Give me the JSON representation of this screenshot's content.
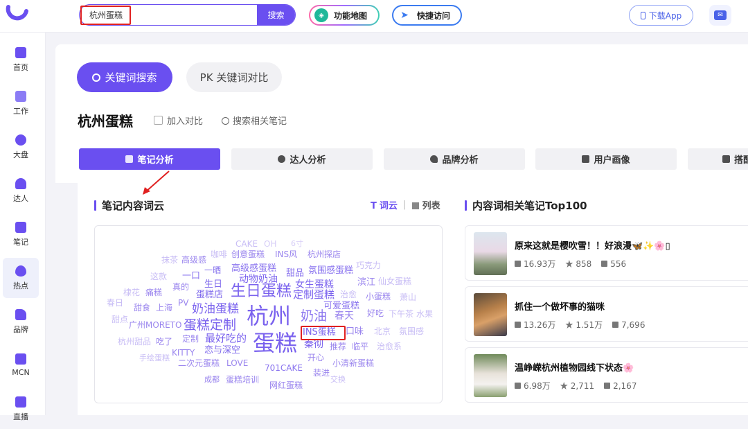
{
  "topbar": {
    "search_value": "杭州蛋糕",
    "search_button": "搜索",
    "feature_map": "功能地图",
    "quick_access": "快捷访问",
    "download_app": "下载App"
  },
  "sidebar": {
    "items": [
      {
        "label": "首页"
      },
      {
        "label": "工作"
      },
      {
        "label": "大盘"
      },
      {
        "label": "达人"
      },
      {
        "label": "笔记"
      },
      {
        "label": "热点"
      },
      {
        "label": "品牌"
      },
      {
        "label": "MCN"
      },
      {
        "label": "直播"
      }
    ]
  },
  "main": {
    "tab_keyword": "关键词搜索",
    "tab_pk": "PK 关键词对比",
    "title": "杭州蛋糕",
    "add_compare": "加入对比",
    "search_notes": "搜索相关笔记",
    "sub_tabs": [
      {
        "label": "笔记分析"
      },
      {
        "label": "达人分析"
      },
      {
        "label": "品牌分析"
      },
      {
        "label": "用户画像"
      },
      {
        "label": "搭配"
      }
    ]
  },
  "cloud_section": {
    "title": "笔记内容词云",
    "toggle_cloud": "词云",
    "toggle_list": "列表",
    "words": [
      {
        "text": "CAKE"
      },
      {
        "text": "OH"
      },
      {
        "text": "6寸"
      },
      {
        "text": "抹茶"
      },
      {
        "text": "高级感"
      },
      {
        "text": "咖啡"
      },
      {
        "text": "创意蛋糕"
      },
      {
        "text": "INS风"
      },
      {
        "text": "杭州探店"
      },
      {
        "text": "一晒"
      },
      {
        "text": "高级感蛋糕"
      },
      {
        "text": "甜品"
      },
      {
        "text": "氛围感蛋糕"
      },
      {
        "text": "巧克力"
      },
      {
        "text": "这款"
      },
      {
        "text": "一口"
      },
      {
        "text": "动物奶油"
      },
      {
        "text": "滨江"
      },
      {
        "text": "仙女蛋糕"
      },
      {
        "text": "生日"
      },
      {
        "text": "女生蛋糕"
      },
      {
        "text": "棣花"
      },
      {
        "text": "痛糕"
      },
      {
        "text": "真的"
      },
      {
        "text": "蛋糕店"
      },
      {
        "text": "生日蛋糕"
      },
      {
        "text": "定制蛋糕"
      },
      {
        "text": "治愈"
      },
      {
        "text": "小蛋糕"
      },
      {
        "text": "萧山"
      },
      {
        "text": "春日"
      },
      {
        "text": "甜食"
      },
      {
        "text": "上海"
      },
      {
        "text": "PV"
      },
      {
        "text": "奶油蛋糕"
      },
      {
        "text": "杭州"
      },
      {
        "text": "可爱蛋糕"
      },
      {
        "text": "甜点"
      },
      {
        "text": "奶油"
      },
      {
        "text": "春天"
      },
      {
        "text": "好吃"
      },
      {
        "text": "下午茶"
      },
      {
        "text": "水果"
      },
      {
        "text": "广州MORETO"
      },
      {
        "text": "蛋糕定制"
      },
      {
        "text": "口味"
      },
      {
        "text": "北京"
      },
      {
        "text": "氛围感"
      },
      {
        "text": "杭州甜品"
      },
      {
        "text": "吃了"
      },
      {
        "text": "定制"
      },
      {
        "text": "最好吃的"
      },
      {
        "text": "蛋糕"
      },
      {
        "text": "INS蛋糕"
      },
      {
        "text": "秦彻"
      },
      {
        "text": "推荐"
      },
      {
        "text": "临平"
      },
      {
        "text": "治愈系"
      },
      {
        "text": "KITTY"
      },
      {
        "text": "恋与深空"
      },
      {
        "text": "手绘蛋糕"
      },
      {
        "text": "开心"
      },
      {
        "text": "二次元蛋糕"
      },
      {
        "text": "LOVE"
      },
      {
        "text": "小清新蛋糕"
      },
      {
        "text": "701CAKE"
      },
      {
        "text": "装进"
      },
      {
        "text": "成都"
      },
      {
        "text": "蛋糕培训"
      },
      {
        "text": "交换"
      },
      {
        "text": "网红蛋糕"
      }
    ]
  },
  "top_section": {
    "title": "内容词相关笔记Top100",
    "cards": [
      {
        "title": "原来这就是樱吹雪！！好浪漫🦋✨🌸▯",
        "likes": "16.93万",
        "collects": "858",
        "comments": "556"
      },
      {
        "title": "抓住一个做坏事的猫咪",
        "likes": "13.26万",
        "collects": "1.51万",
        "comments": "7,696"
      },
      {
        "title": "温峥嵘杭州植物园线下状态🌸",
        "likes": "6.98万",
        "collects": "2,711",
        "comments": "2,167"
      }
    ]
  },
  "colors": {
    "accent": "#6a4ff0",
    "highlight": "#e02020",
    "word_light": "#c8bdf5",
    "word_mid": "#9a85ee",
    "word_dark": "#6a4ff0"
  }
}
